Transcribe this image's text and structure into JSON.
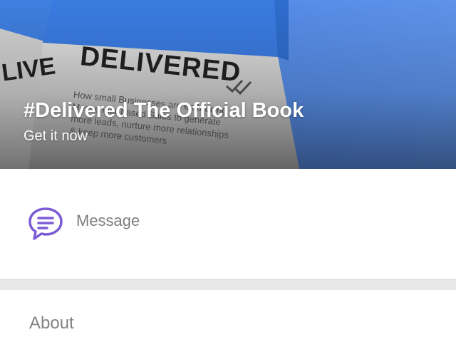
{
  "banner": {
    "title": "#Delivered The Official Book",
    "subtitle": "Get it now",
    "book_word": "DELIVERED",
    "book_tagline_lines": [
      "How small Businesses are embracing",
      "Messenger-based Sales to generate",
      "more leads, nurture more relationships",
      "& keep more customers"
    ],
    "side_book_word": "LIVE",
    "colors": {
      "sky": "#5d8fe6",
      "book_blue": "#3b7de0",
      "accent_purple": "#7c5cd6"
    }
  },
  "actions": {
    "message_label": "Message",
    "message_icon": "chat-bubble-icon"
  },
  "sections": {
    "about_label": "About"
  }
}
